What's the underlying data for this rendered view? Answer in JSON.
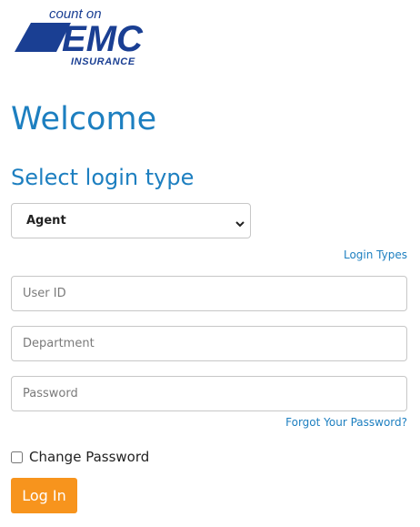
{
  "logo": {
    "tagline": "count on",
    "brand": "EMC",
    "sub": "INSURANCE",
    "color": "#1a3f93"
  },
  "page": {
    "title": "Welcome",
    "subtitle": "Select login type"
  },
  "login_type": {
    "selected": "Agent",
    "link": "Login Types"
  },
  "fields": {
    "user_id_placeholder": "User ID",
    "department_placeholder": "Department",
    "password_placeholder": "Password"
  },
  "forgot_password": "Forgot Your Password?",
  "change_password": {
    "label": "Change Password",
    "checked": false
  },
  "login_button": "Log In",
  "colors": {
    "accent": "#1d7fc0",
    "button": "#f7941d",
    "logo": "#1a3f93"
  }
}
